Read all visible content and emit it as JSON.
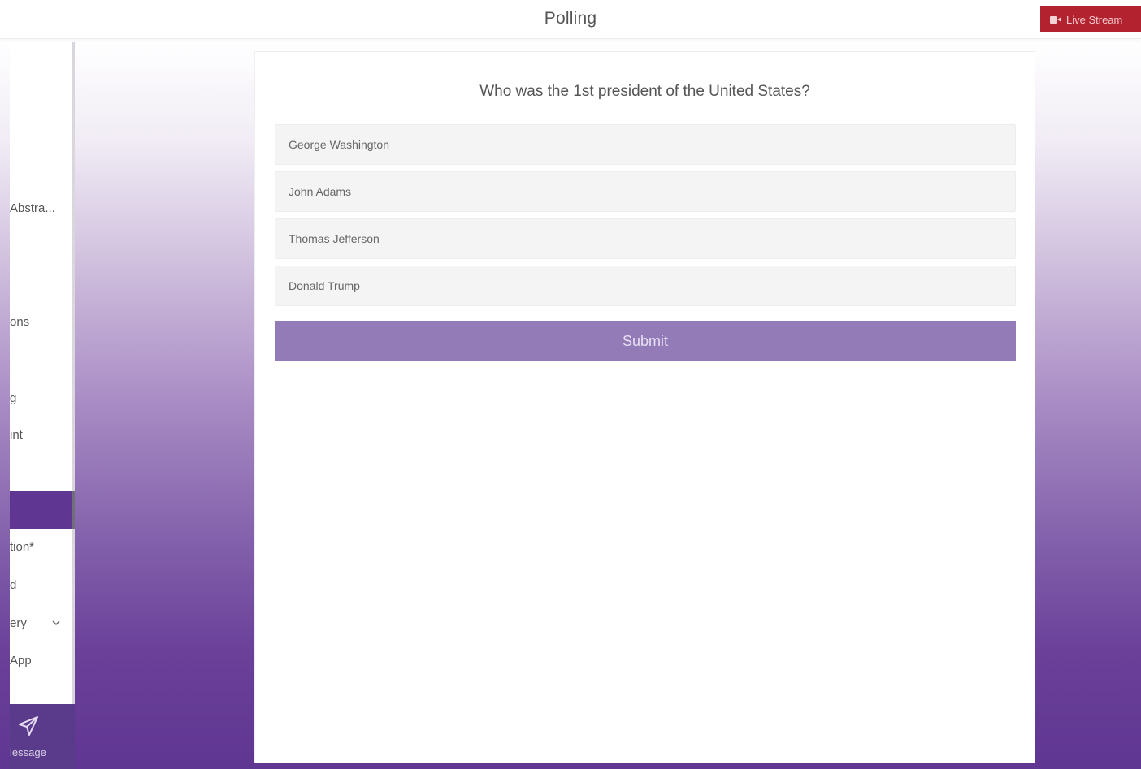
{
  "header": {
    "title": "Polling",
    "live_stream_label": "Live Stream",
    "live_stream_color": "#b3232f"
  },
  "sidebar": {
    "items": [
      {
        "label": "Abstra..."
      },
      {
        "label": "ons"
      },
      {
        "label": "g"
      },
      {
        "label": "int"
      },
      {
        "label": "tion*"
      },
      {
        "label": "d"
      },
      {
        "label": "ery"
      },
      {
        "label": "App"
      }
    ],
    "active_color": "#5f3692",
    "message_label": "lessage"
  },
  "poll": {
    "question": "Who was the 1st president of the United States?",
    "options": [
      {
        "label": "George Washington"
      },
      {
        "label": "John Adams"
      },
      {
        "label": "Thomas Jefferson"
      },
      {
        "label": "Donald Trump"
      }
    ],
    "submit_label": "Submit",
    "submit_color": "#937bb8"
  },
  "icons": {
    "live_stream": "camera-icon",
    "message": "paper-plane-icon",
    "dropdown": "chevron-down-icon"
  }
}
